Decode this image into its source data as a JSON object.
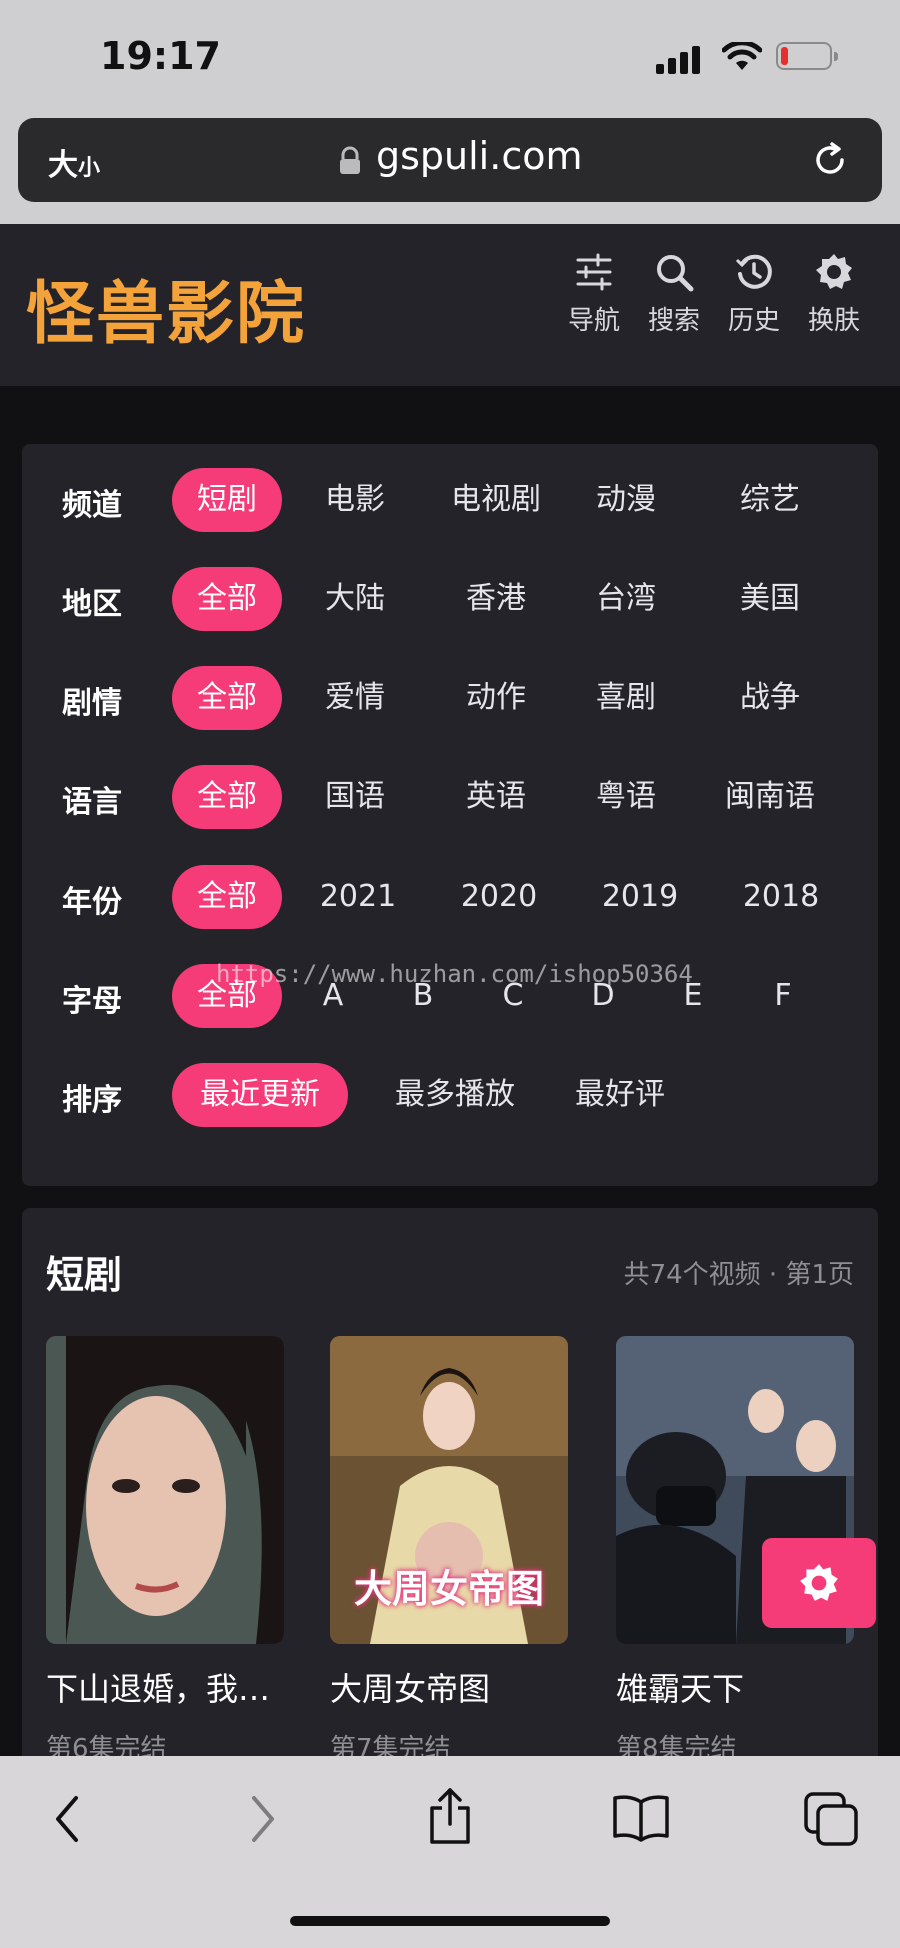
{
  "status_bar": {
    "time": "19:17"
  },
  "browser": {
    "text_size_label": "大",
    "text_size_small": "小",
    "domain": "gspuli.com"
  },
  "site": {
    "logo": "怪兽影院",
    "nav": [
      {
        "label": "导航",
        "icon": "sliders-icon"
      },
      {
        "label": "搜索",
        "icon": "search-icon"
      },
      {
        "label": "历史",
        "icon": "history-icon"
      },
      {
        "label": "换肤",
        "icon": "gear-icon"
      }
    ]
  },
  "filters": [
    {
      "label": "频道",
      "options": [
        "短剧",
        "电影",
        "电视剧",
        "动漫",
        "综艺"
      ],
      "active": 0
    },
    {
      "label": "地区",
      "options": [
        "全部",
        "大陆",
        "香港",
        "台湾",
        "美国"
      ],
      "active": 0
    },
    {
      "label": "剧情",
      "options": [
        "全部",
        "爱情",
        "动作",
        "喜剧",
        "战争"
      ],
      "active": 0
    },
    {
      "label": "语言",
      "options": [
        "全部",
        "国语",
        "英语",
        "粤语",
        "闽南语"
      ],
      "active": 0
    },
    {
      "label": "年份",
      "options": [
        "全部",
        "2021",
        "2020",
        "2019",
        "2018"
      ],
      "active": 0
    },
    {
      "label": "字母",
      "options": [
        "全部",
        "A",
        "B",
        "C",
        "D",
        "E",
        "F"
      ],
      "active": 0
    },
    {
      "label": "排序",
      "options": [
        "最近更新",
        "最多播放",
        "最好评"
      ],
      "active": 0
    }
  ],
  "watermark": "https://www.huzhan.com/ishop50364",
  "videos": {
    "title": "短剧",
    "count_text": "共74个视频 · 第1页",
    "items": [
      {
        "title": "下山退婚，我…",
        "status": "第6集完结"
      },
      {
        "title": "大周女帝图",
        "status": "第7集完结",
        "overlay": "大周女帝图"
      },
      {
        "title": "雄霸天下",
        "status": "第8集完结"
      }
    ]
  },
  "colors": {
    "accent": "#f63c78",
    "logo": "#f4a33a",
    "panel": "#242329"
  },
  "toolbar": [
    "back-icon",
    "forward-icon",
    "share-icon",
    "bookmarks-icon",
    "tabs-icon"
  ]
}
